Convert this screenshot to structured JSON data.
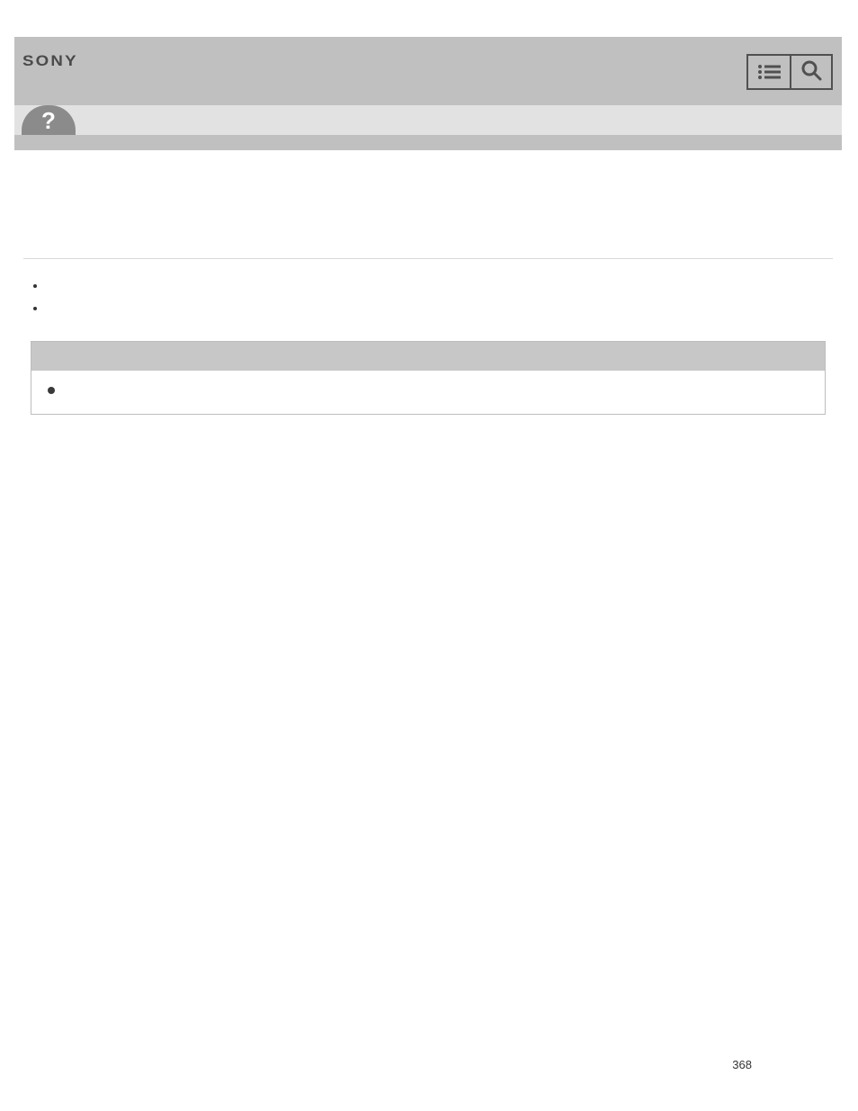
{
  "header": {
    "logo_text": "SONY"
  },
  "page_number": "368"
}
